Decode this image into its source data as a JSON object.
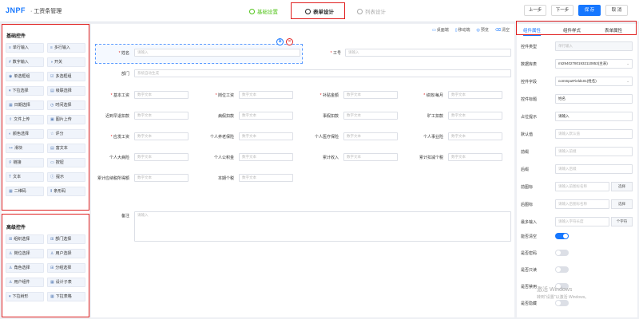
{
  "header": {
    "logo": "JNPF",
    "app_name": "· 工资条管理",
    "steps": [
      "基础设置",
      "表单设计",
      "列表设计"
    ],
    "prev": "上一步",
    "next": "下一步",
    "save": "保 存",
    "cancel": "取 消"
  },
  "left": {
    "basic_title": "基础控件",
    "advanced_title": "高级控件",
    "basic": [
      [
        "≡",
        "单行输入"
      ],
      [
        "≡",
        "多行输入"
      ],
      [
        "#",
        "数字输入"
      ],
      [
        "◑",
        "开关"
      ],
      [
        "◉",
        "单选框组"
      ],
      [
        "☑",
        "多选框组"
      ],
      [
        "▾",
        "下拉选择"
      ],
      [
        "▤",
        "级联选择"
      ],
      [
        "▦",
        "日期选择"
      ],
      [
        "◷",
        "时间选择"
      ],
      [
        "⇪",
        "文件上传"
      ],
      [
        "▣",
        "图片上传"
      ],
      [
        "◐",
        "颜色选择"
      ],
      [
        "☆",
        "评分"
      ],
      [
        "⊶",
        "滑块"
      ],
      [
        "▤",
        "富文本"
      ],
      [
        "⚲",
        "链接"
      ],
      [
        "▭",
        "按钮"
      ],
      [
        "T",
        "文本"
      ],
      [
        "ⓘ",
        "提示"
      ],
      [
        "▦",
        "二维码"
      ],
      [
        "⦀",
        "条形码"
      ]
    ],
    "advanced": [
      [
        "⊞",
        "组织选择"
      ],
      [
        "⊞",
        "部门选择"
      ],
      [
        "♙",
        "岗位选择"
      ],
      [
        "♙",
        "用户选择"
      ],
      [
        "♙",
        "角色选择"
      ],
      [
        "⊞",
        "分组选择"
      ],
      [
        "♙",
        "用户组件"
      ],
      [
        "▦",
        "设计子表"
      ],
      [
        "▾",
        "下拉树形"
      ],
      [
        "▦",
        "下拉表格"
      ]
    ]
  },
  "canvas": {
    "tools": [
      "桌面端",
      "移动端",
      "预览",
      "清空"
    ],
    "row1": {
      "name_label": "姓名",
      "name_ph": "请输入",
      "id_label": "工号",
      "id_ph": "请输入"
    },
    "dept": {
      "label": "部门",
      "ph": "系统自动生成"
    },
    "grid_ph": "数字文本",
    "grid": [
      [
        "基本工资",
        "岗位工资",
        "补贴金额",
        "绩效/每月"
      ],
      [
        "迟到早退扣款",
        "病假扣款",
        "事假扣款",
        "旷工扣款"
      ],
      [
        "应发工资",
        "个人养老保险",
        "个人医疗保险",
        "个人事业险"
      ],
      [
        "个人大病险",
        "个人公积金",
        "累计收入",
        "累计扣减个税"
      ],
      [
        "累计应纳税所得额",
        "本期个税",
        "",
        ""
      ]
    ],
    "required": [
      [
        true,
        true,
        true,
        true
      ],
      [
        false,
        false,
        false,
        false
      ],
      [
        true,
        false,
        false,
        false
      ],
      [
        false,
        false,
        false,
        false
      ],
      [
        false,
        false,
        false,
        false
      ]
    ],
    "remark": {
      "label": "备注",
      "ph": "请输入"
    }
  },
  "right": {
    "tabs": [
      "组件属性",
      "组件样式",
      "表单属性"
    ],
    "props": [
      {
        "label": "控件类型",
        "value": "单行输入",
        "kind": "dis"
      },
      {
        "label": "数据库表",
        "value": "mt294027801932110853(主表)",
        "kind": "sel"
      },
      {
        "label": "控件字段",
        "value": "comInputField101(姓名)",
        "kind": "sel"
      },
      {
        "label": "控件标题",
        "value": "姓名",
        "kind": "val"
      },
      {
        "label": "占位提示",
        "value": "请输入",
        "kind": "val"
      },
      {
        "label": "默认值",
        "value": "请输入默认值",
        "kind": "ph"
      },
      {
        "label": "前缀",
        "value": "请输入前缀",
        "kind": "ph"
      },
      {
        "label": "后缀",
        "value": "请输入后缀",
        "kind": "ph"
      },
      {
        "label": "前图标",
        "value": "请输入前图标名称",
        "kind": "ph",
        "addon": "选择"
      },
      {
        "label": "后图标",
        "value": "请输入后图标名称",
        "kind": "ph",
        "addon": "选择"
      },
      {
        "label": "最多输入",
        "value": "请输入字符长度",
        "kind": "ph",
        "addon": "个字符"
      }
    ],
    "toggles": [
      {
        "label": "能否清空",
        "on": true
      },
      {
        "label": "是否密码",
        "on": false
      },
      {
        "label": "是否只读",
        "on": false
      },
      {
        "label": "是否禁用",
        "on": false
      },
      {
        "label": "是否隐藏",
        "on": false
      }
    ]
  },
  "watermark": {
    "line1": "激活 Windows",
    "line2": "转到\"设置\"以激活 Windows。"
  }
}
